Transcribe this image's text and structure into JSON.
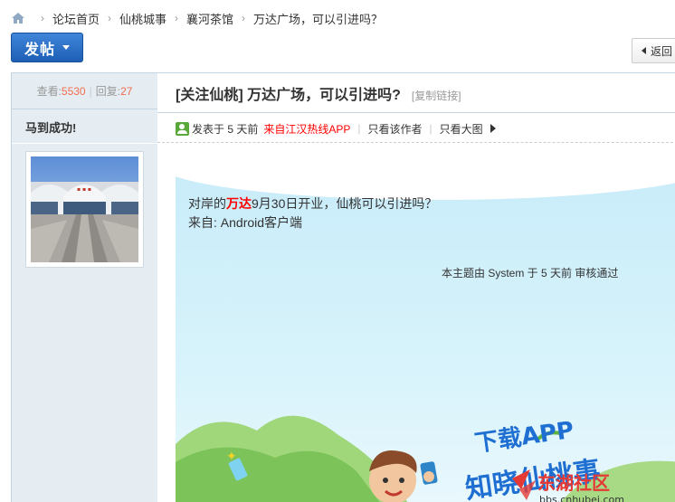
{
  "breadcrumb": {
    "items": [
      "论坛首页",
      "仙桃城事",
      "襄河茶馆",
      "万达广场，可以引进吗？"
    ]
  },
  "toolbar": {
    "post_label": "发帖",
    "back_label": "返回"
  },
  "stats": {
    "views_label": "查看:",
    "views": "5530",
    "replies_label": "回复:",
    "replies": "27"
  },
  "author": {
    "name": "马到成功!"
  },
  "thread": {
    "title": "[关注仙桃] 万达广场，可以引进吗?",
    "copy_link": "[复制链接]"
  },
  "meta": {
    "posted": "发表于 5 天前",
    "source": "来自江汉热线APP",
    "only_author": "只看该作者",
    "large_image": "只看大图"
  },
  "post": {
    "text_before": "对岸的",
    "highlight": "万达",
    "text_after": "9月30日开业，仙桃可以引进吗？",
    "from_line": "来自: Android客户端",
    "review_note": "本主题由 System 于 5 天前 审核通过"
  },
  "promo": {
    "line1": "下载APP",
    "line2": "知晓仙桃事",
    "watermark": "东湖社区",
    "watermark_url": "bbs.cnhubei.com"
  },
  "colors": {
    "accent": "#1d5fb5",
    "stat_number": "#f26c4f",
    "highlight": "#ff0000",
    "sidebar_bg": "#e5edf2"
  }
}
